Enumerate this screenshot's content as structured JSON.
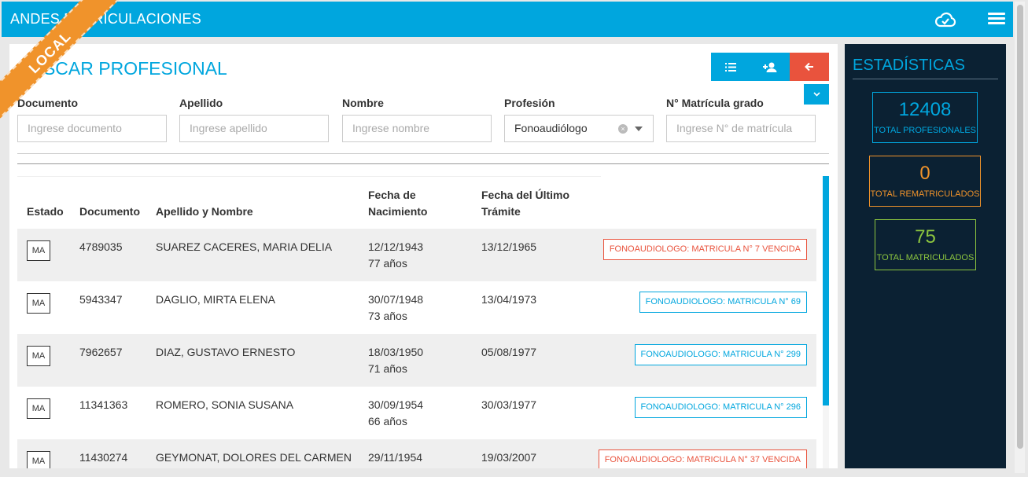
{
  "app": {
    "title": "ANDES MATRICULACIONES",
    "env_ribbon": "LOCAL"
  },
  "page": {
    "title": "BUSCAR PROFESIONAL"
  },
  "filters": {
    "documento": {
      "label": "Documento",
      "placeholder": "Ingrese documento"
    },
    "apellido": {
      "label": "Apellido",
      "placeholder": "Ingrese apellido"
    },
    "nombre": {
      "label": "Nombre",
      "placeholder": "Ingrese nombre"
    },
    "profesion": {
      "label": "Profesión",
      "value": "Fonoaudiólogo"
    },
    "matricula": {
      "label": "N° Matrícula grado",
      "placeholder": "Ingrese N° de matrícula"
    }
  },
  "table": {
    "headers": {
      "estado": "Estado",
      "documento": "Documento",
      "nombre": "Apellido y Nombre",
      "nacimiento_1": "Fecha de",
      "nacimiento_2": "Nacimiento",
      "tramite_1": "Fecha del Último",
      "tramite_2": "Trámite"
    },
    "rows": [
      {
        "estado": "MA",
        "documento": "4789035",
        "nombre": "SUAREZ CACERES, MARIA DELIA",
        "nacimiento": "12/12/1943",
        "edad": "77 años",
        "tramite": "13/12/1965",
        "matricula": "FONOAUDIOLOGO: MATRICULA N° 7 VENCIDA",
        "matricula_status": "red"
      },
      {
        "estado": "MA",
        "documento": "5943347",
        "nombre": "DAGLIO, MIRTA ELENA",
        "nacimiento": "30/07/1948",
        "edad": "73 años",
        "tramite": "13/04/1973",
        "matricula": "FONOAUDIOLOGO: MATRICULA N° 69",
        "matricula_status": "blue"
      },
      {
        "estado": "MA",
        "documento": "7962657",
        "nombre": "DIAZ, GUSTAVO ERNESTO",
        "nacimiento": "18/03/1950",
        "edad": "71 años",
        "tramite": "05/08/1977",
        "matricula": "FONOAUDIOLOGO: MATRICULA N° 299",
        "matricula_status": "blue"
      },
      {
        "estado": "MA",
        "documento": "11341363",
        "nombre": "ROMERO, SONIA SUSANA",
        "nacimiento": "30/09/1954",
        "edad": "66 años",
        "tramite": "30/03/1977",
        "matricula": "FONOAUDIOLOGO: MATRICULA N° 296",
        "matricula_status": "blue"
      },
      {
        "estado": "MA",
        "documento": "11430274",
        "nombre": "GEYMONAT, DOLORES DEL CARMEN",
        "nacimiento": "29/11/1954",
        "edad": "",
        "tramite": "19/03/2007",
        "matricula": "FONOAUDIOLOGO: MATRICULA N° 37 VENCIDA",
        "matricula_status": "red"
      }
    ]
  },
  "stats": {
    "title": "ESTADÍSTICAS",
    "total_profesionales": {
      "value": "12408",
      "label": "TOTAL PROFESIONALES"
    },
    "total_rematriculados": {
      "value": "0",
      "label": "TOTAL REMATRICULADOS"
    },
    "total_matriculados": {
      "value": "75",
      "label": "TOTAL MATRICULADOS"
    }
  },
  "colors": {
    "accent": "#00a6de",
    "danger": "#e9533d",
    "warning": "#f0932b",
    "success": "#8dc63f",
    "sidebar": "#0b2133"
  },
  "icons": [
    "cloud-check-icon",
    "hamburger-menu-icon",
    "list-icon",
    "add-user-icon",
    "arrow-left-icon",
    "chevron-down-icon",
    "clear-icon",
    "caret-down-icon"
  ]
}
